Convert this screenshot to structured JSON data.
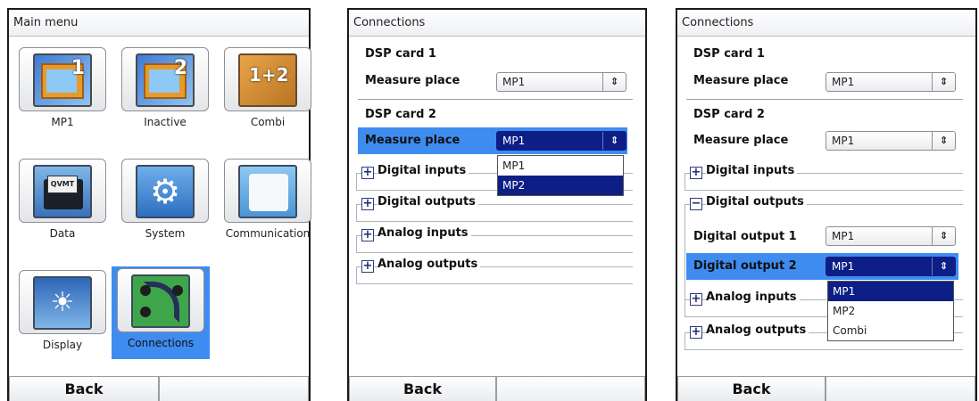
{
  "screen1": {
    "title": "Main menu",
    "items": [
      {
        "label": "MP1",
        "icon": "mp1-icon"
      },
      {
        "label": "Inactive",
        "icon": "mp2-icon"
      },
      {
        "label": "Combi",
        "icon": "combi-icon"
      },
      {
        "label": "Data",
        "icon": "data-folder-icon"
      },
      {
        "label": "System",
        "icon": "gears-icon"
      },
      {
        "label": "Communication",
        "icon": "communication-icon"
      },
      {
        "label": "Display",
        "icon": "brightness-icon"
      },
      {
        "label": "Connections",
        "icon": "connections-icon",
        "selected": true
      }
    ],
    "mp1_num": "1",
    "mp2_num": "2",
    "combi_num": "1+2",
    "data_paper": "QVMT",
    "back_label": "Back"
  },
  "screen2": {
    "title": "Connections",
    "dsp1_title": "DSP card 1",
    "dsp1_label": "Measure place",
    "dsp1_value": "MP1",
    "dsp2_title": "DSP card 2",
    "dsp2_label": "Measure place",
    "dsp2_value": "MP1",
    "dropdown_options": [
      "MP1",
      "MP2"
    ],
    "groups": [
      "Digital inputs",
      "Digital outputs",
      "Analog inputs",
      "Analog outputs"
    ],
    "back_label": "Back"
  },
  "screen3": {
    "title": "Connections",
    "dsp1_title": "DSP card 1",
    "dsp1_label": "Measure place",
    "dsp1_value": "MP1",
    "dsp2_title": "DSP card 2",
    "dsp2_label": "Measure place",
    "dsp2_value": "MP1",
    "group_digital_inputs": "Digital inputs",
    "group_digital_outputs": "Digital outputs",
    "dout1_label": "Digital output 1",
    "dout1_value": "MP1",
    "dout2_label": "Digital output 2",
    "dout2_value": "MP1",
    "dropdown_options": [
      "MP1",
      "MP2",
      "Combi"
    ],
    "group_analog_inputs": "Analog inputs",
    "group_analog_outputs": "Analog outputs",
    "back_label": "Back"
  },
  "colors": {
    "selection_blue": "#3f8cf0",
    "dropdown_selected": "#0d1f86"
  }
}
